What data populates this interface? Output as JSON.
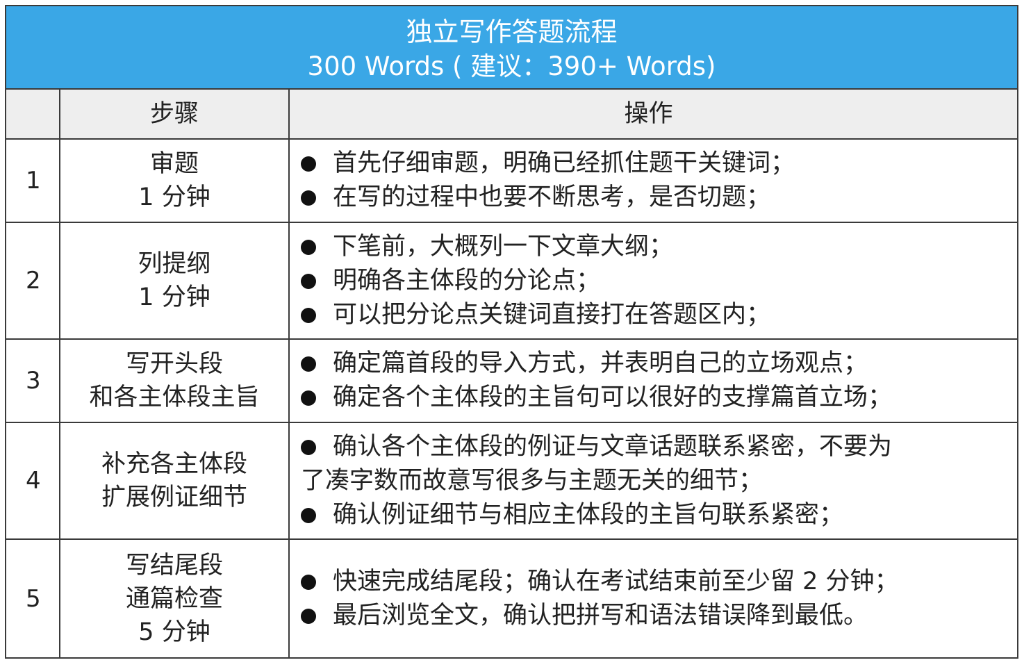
{
  "title": {
    "line1": "独立写作答题流程",
    "line2": "300 Words ( 建议：390+ Words)"
  },
  "header": {
    "num": "",
    "step": "步骤",
    "op": "操作"
  },
  "rows": [
    {
      "num": "1",
      "step": [
        "审题",
        "1 分钟"
      ],
      "ops": [
        "首先仔细审题，明确已经抓住题干关键词；",
        "在写的过程中也要不断思考，是否切题；"
      ]
    },
    {
      "num": "2",
      "step": [
        "列提纲",
        "1 分钟"
      ],
      "ops": [
        "下笔前，大概列一下文章大纲；",
        "明确各主体段的分论点；",
        "可以把分论点关键词直接打在答题区内；"
      ]
    },
    {
      "num": "3",
      "step": [
        "写开头段",
        "和各主体段主旨"
      ],
      "ops": [
        "确定篇首段的导入方式，并表明自己的立场观点；",
        "确定各个主体段的主旨句可以很好的支撑篇首立场；"
      ]
    },
    {
      "num": "4",
      "step": [
        "补充各主体段",
        "扩展例证细节"
      ],
      "ops": [
        "确认各个主体段的例证与文章话题联系紧密，不要为",
        "了凑字数而故意写很多与主题无关的细节；",
        "确认例证细节与相应主体段的主旨句联系紧密；"
      ]
    },
    {
      "num": "5",
      "step": [
        "写结尾段",
        "通篇检查",
        "5 分钟"
      ],
      "ops": [
        "快速完成结尾段；确认在考试结束前至少留 2 分钟；",
        "最后浏览全文，确认把拼写和语法错误降到最低。"
      ]
    }
  ]
}
